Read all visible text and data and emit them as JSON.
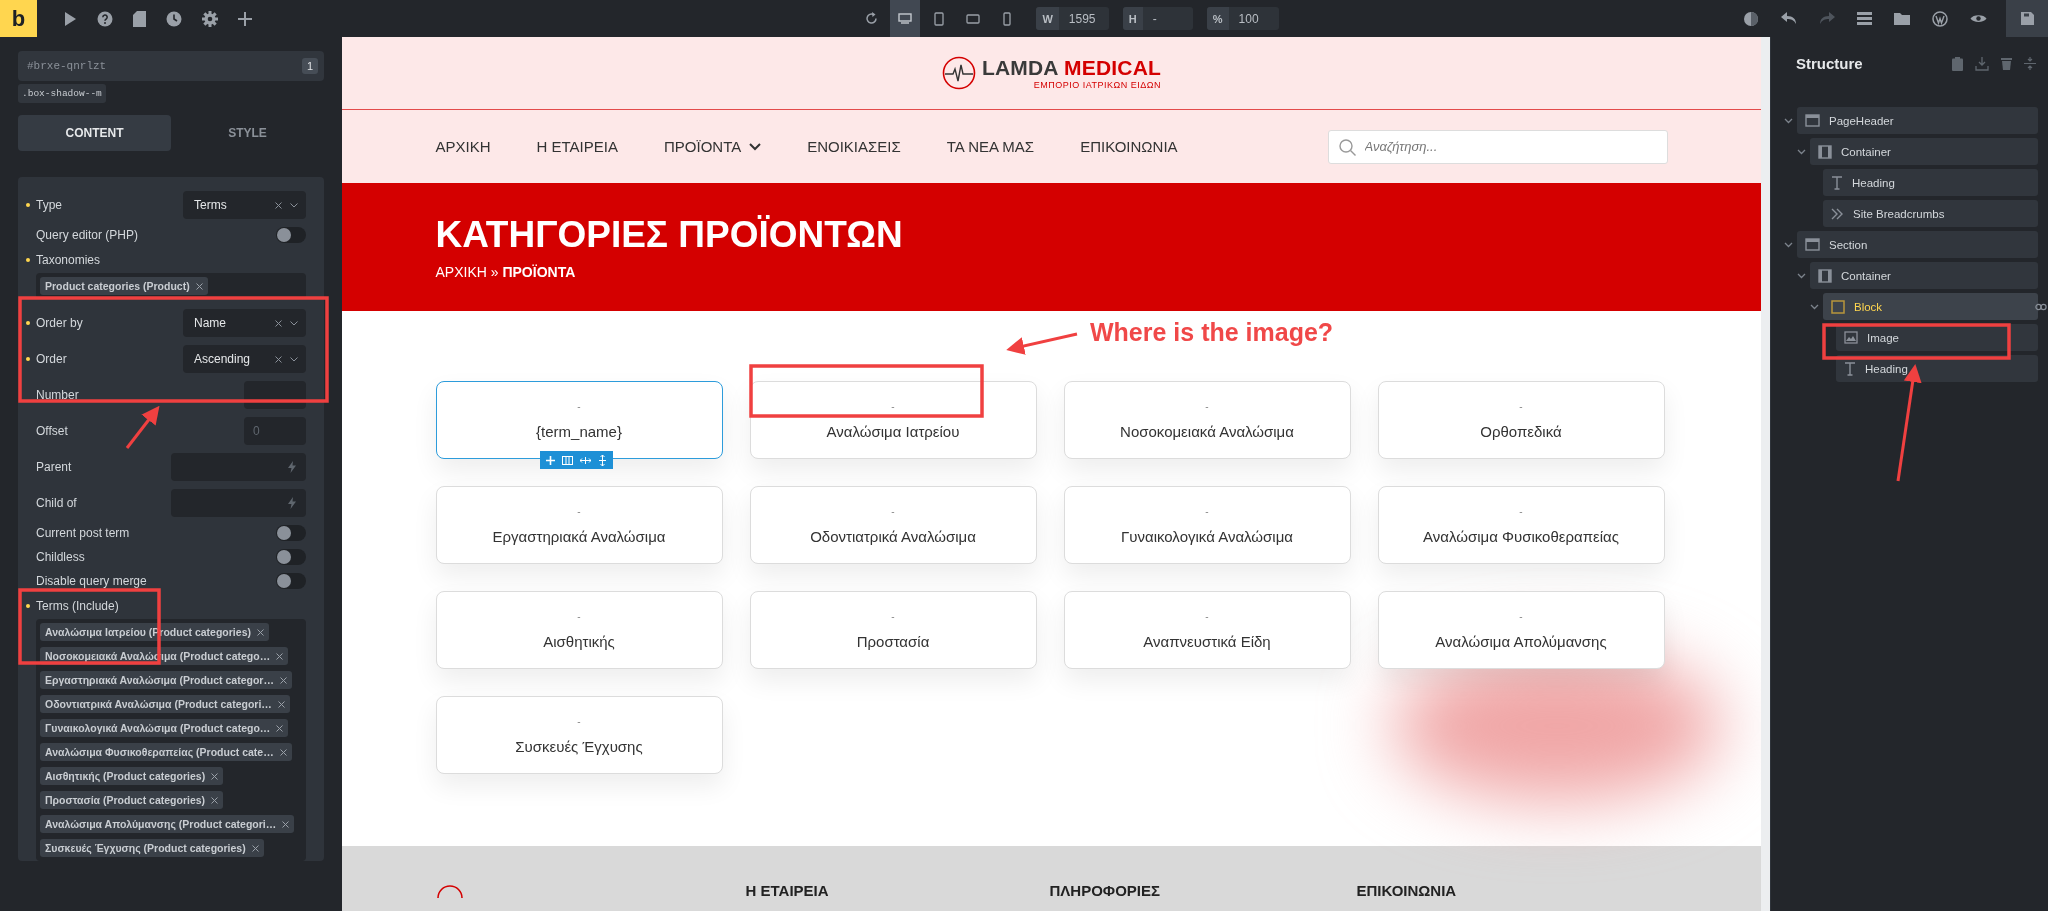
{
  "topbar": {
    "logo": "b",
    "devices": [
      {
        "kind": "desktop",
        "selected": true
      },
      {
        "kind": "tablet",
        "selected": false
      },
      {
        "kind": "landscape",
        "selected": false
      },
      {
        "kind": "mobile",
        "selected": false
      }
    ],
    "size_fields": [
      {
        "label": "W",
        "value": "1595"
      },
      {
        "label": "H",
        "value": "-"
      },
      {
        "label": "%",
        "value": "100"
      }
    ]
  },
  "left_panel": {
    "element_id": "#brxe-qnrlzt",
    "count": "1",
    "class_chip": ".box-shadow--m",
    "tabs": [
      {
        "label": "CONTENT",
        "selected": true
      },
      {
        "label": "STYLE",
        "selected": false
      }
    ],
    "controls": [
      {
        "kind": "select",
        "label": "Type",
        "value": "Terms",
        "set": true
      },
      {
        "kind": "toggle",
        "label": "Query editor (PHP)",
        "on": false,
        "set": false
      },
      {
        "kind": "tags",
        "label": "Taxonomies",
        "set": true,
        "tags": [
          "Product categories (Product)"
        ]
      },
      {
        "kind": "select",
        "label": "Order by",
        "value": "Name",
        "set": true
      },
      {
        "kind": "select",
        "label": "Order",
        "value": "Ascending",
        "set": true
      },
      {
        "kind": "input",
        "label": "Number",
        "set": false
      },
      {
        "kind": "input",
        "label": "Offset",
        "placeholder": "0",
        "set": false
      },
      {
        "kind": "dynamic",
        "label": "Parent",
        "set": false
      },
      {
        "kind": "dynamic",
        "label": "Child of",
        "set": false
      },
      {
        "kind": "toggle",
        "label": "Current post term",
        "on": false,
        "set": false
      },
      {
        "kind": "toggle",
        "label": "Childless",
        "on": false,
        "set": false
      },
      {
        "kind": "toggle",
        "label": "Disable query merge",
        "on": false,
        "set": false
      },
      {
        "kind": "tags",
        "label": "Terms (Include)",
        "set": true,
        "tags": [
          "Αναλώσιμα Ιατρείου (Product categories)",
          "Νοσοκομειακά Αναλώσιμα (Product catego…",
          "Εργαστηριακά Αναλώσιμα (Product categor…",
          "Οδοντιατρικά Αναλώσιμα (Product categori…",
          "Γυναικολογικά Αναλώσιμα (Product catego…",
          "Αναλώσιμα Φυσικοθεραπείας (Product cate…",
          "Αισθητικής (Product categories)",
          "Προστασία (Product categories)",
          "Αναλώσιμα Απολύμανσης (Product categori…",
          "Συσκευές Έγχυσης (Product categories)"
        ]
      }
    ]
  },
  "site": {
    "logo": {
      "name_dark": "LAMDA",
      "name_red": "MEDICAL",
      "tagline": "ΕΜΠΟΡΙΟ ΙΑΤΡΙΚΩΝ ΕΙΔΩΝ"
    },
    "nav": [
      {
        "label": "ΑΡΧΙΚΗ",
        "dropdown": false
      },
      {
        "label": "Η ΕΤΑΙΡΕΙΑ",
        "dropdown": false
      },
      {
        "label": "ΠΡΟΪΟΝΤΑ",
        "dropdown": true
      },
      {
        "label": "ΕΝΟΙΚΙΑΣΕΙΣ",
        "dropdown": false
      },
      {
        "label": "ΤΑ ΝΕΑ ΜΑΣ",
        "dropdown": false
      },
      {
        "label": "ΕΠΙΚΟΙΝΩΝΙΑ",
        "dropdown": false
      }
    ],
    "search": {
      "placeholder": "Αναζήτηση..."
    },
    "banner": {
      "title": "ΚΑΤΗΓΟΡΙΕΣ ΠΡΟΪΟΝΤΩΝ",
      "breadcrumb": "ΑΡΧΙΚΗ » **ΠΡΟΪΟΝΤΑ**"
    },
    "cards": [
      {
        "top": "-",
        "name": "{term_name}",
        "selected": true
      },
      {
        "top": "-",
        "name": "Αναλώσιμα Ιατρείου",
        "selected": false
      },
      {
        "top": "-",
        "name": "Νοσοκομειακά Αναλώσιμα",
        "selected": false
      },
      {
        "top": "-",
        "name": "Ορθοπεδικά",
        "selected": false
      },
      {
        "top": "-",
        "name": "Εργαστηριακά Αναλώσιμα",
        "selected": false
      },
      {
        "top": "-",
        "name": "Οδοντιατρικά Αναλώσιμα",
        "selected": false
      },
      {
        "top": "-",
        "name": "Γυναικολογικά Αναλώσιμα",
        "selected": false
      },
      {
        "top": "-",
        "name": "Αναλώσιμα Φυσικοθεραπείας",
        "selected": false
      },
      {
        "top": "-",
        "name": "Αισθητικής",
        "selected": false
      },
      {
        "top": "-",
        "name": "Προστασία",
        "selected": false
      },
      {
        "top": "-",
        "name": "Αναπνευστικά Είδη",
        "selected": false
      },
      {
        "top": "-",
        "name": "Αναλώσιμα Απολύμανσης",
        "selected": false
      },
      {
        "top": "-",
        "name": "Συσκευές Έγχυσης",
        "selected": false
      }
    ],
    "footer_headings": [
      "Η ΕΤΑΙΡΕΙΑ",
      "ΠΛΗΡΟΦΟΡΙΕΣ",
      "ΕΠΙΚΟΙΝΩΝΙΑ"
    ]
  },
  "annotation": {
    "callout": "Where is the image?"
  },
  "structure": {
    "title": "Structure",
    "tree": [
      {
        "label": "PageHeader",
        "kind": "section",
        "expanded": true,
        "selected": false,
        "children": [
          {
            "label": "Container",
            "kind": "container",
            "expanded": true,
            "selected": false,
            "children": [
              {
                "label": "Heading",
                "kind": "heading",
                "selected": false
              },
              {
                "label": "Site Breadcrumbs",
                "kind": "breadcrumbs",
                "selected": false
              }
            ]
          }
        ]
      },
      {
        "label": "Section",
        "kind": "section",
        "expanded": true,
        "selected": false,
        "children": [
          {
            "label": "Container",
            "kind": "container",
            "expanded": true,
            "selected": false,
            "children": [
              {
                "label": "Block",
                "kind": "block",
                "expanded": true,
                "selected": true,
                "children": [
                  {
                    "label": "Image",
                    "kind": "image",
                    "selected": false
                  },
                  {
                    "label": "Heading",
                    "kind": "heading",
                    "selected": false
                  }
                ]
              }
            ]
          }
        ]
      }
    ]
  }
}
